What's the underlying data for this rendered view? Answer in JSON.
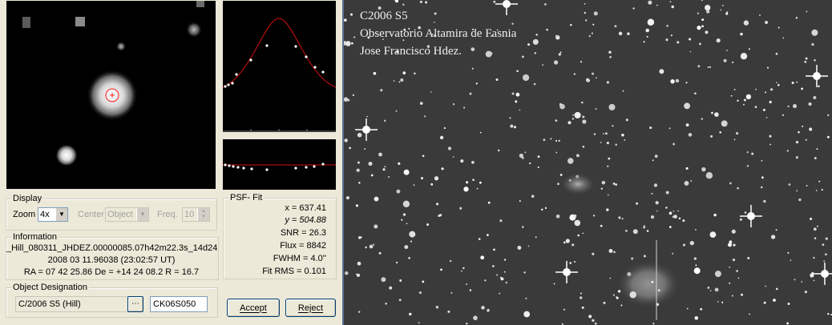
{
  "display": {
    "title": "Display",
    "zoom_label": "Zoom",
    "zoom_value": "4x",
    "center_label": "Center",
    "center_value": "Object",
    "freq_label": "Freq.",
    "freq_value": "10"
  },
  "information": {
    "title": "Information",
    "line1": "_Hill_080311_JHDEZ.00000085.07h42m22.3s_14d24",
    "line2": "2008 03 11.96038 (23:02:57 UT)",
    "line3": "RA = 07 42 25.86   De = +14 24 08.2   R = 16.7"
  },
  "designation": {
    "title": "Object Designation",
    "name_value": "C/2006 S5 (Hill)",
    "code_value": "CK06S050"
  },
  "psf": {
    "title": "PSF- Fit",
    "x_line": "x = 637.41",
    "y_line": "y = 504.88",
    "snr_line": "SNR = 26.3",
    "flux_line": "Flux = 8842",
    "fwhm_line": "FWHM = 4.0''",
    "rms_line": "Fit RMS = 0.101"
  },
  "buttons": {
    "accept": "Accept",
    "reject": "Reject"
  },
  "image_overlay": {
    "line1": "C2006 S5",
    "line2": "Observatorio Altamira de Fasnia",
    "line3": "Jose Francisco Hdez."
  },
  "colors": {
    "fit_curve": "#d01010",
    "window_bg": "#ece9d8",
    "target_circle": "#ff2020"
  }
}
